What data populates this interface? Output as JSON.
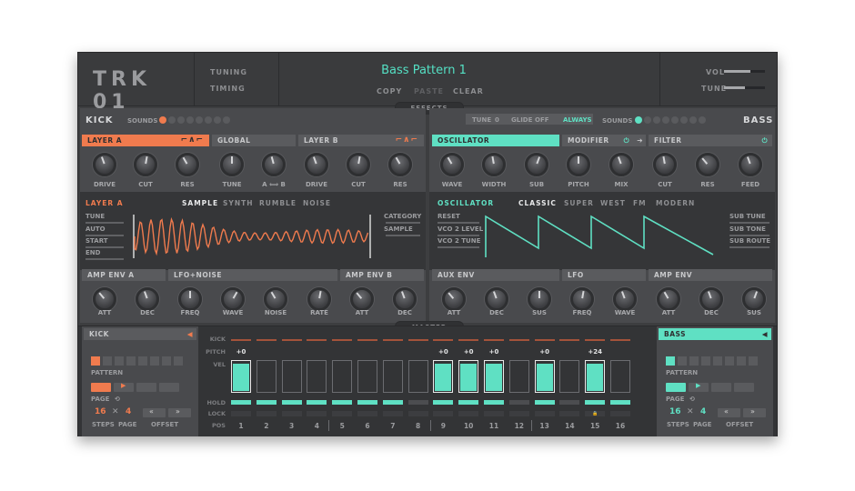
{
  "header": {
    "logo": "TRK 01",
    "tuning": "TUNING",
    "timing": "TIMING",
    "preset": "Bass Pattern 1",
    "copy": "COPY",
    "paste": "PASTE",
    "clear": "CLEAR",
    "vol": "VOL",
    "tune": "TUNE",
    "vol_level": 0.65,
    "tune_level": 0.5
  },
  "tabs": {
    "effects": "EFFECTS",
    "master": "MASTER"
  },
  "kick": {
    "title": "KICK",
    "sounds": "SOUNDS",
    "layer_a": "LAYER A",
    "global": "GLOBAL",
    "layer_b": "LAYER B",
    "knobs": [
      {
        "label": "DRIVE",
        "angle": -20
      },
      {
        "label": "CUT",
        "angle": 10
      },
      {
        "label": "RES",
        "angle": -30
      },
      {
        "label": "TUNE",
        "angle": 0
      },
      {
        "label": "A ⟺ B",
        "angle": -15
      },
      {
        "label": "DRIVE",
        "angle": -20
      },
      {
        "label": "CUT",
        "angle": 10
      },
      {
        "label": "RES",
        "angle": -30
      }
    ],
    "mode_label": "LAYER A",
    "modes": [
      "SAMPLE",
      "SYNTH",
      "RUMBLE",
      "NOISE"
    ],
    "params_left": [
      "TUNE",
      "AUTO",
      "START",
      "END"
    ],
    "params_right": [
      "CATEGORY",
      "SAMPLE"
    ],
    "env_a": "AMP ENV A",
    "lfo": "LFO+NOISE",
    "env_b": "AMP ENV B",
    "env_knobs": [
      {
        "label": "ATT",
        "angle": -40
      },
      {
        "label": "DEC",
        "angle": -20
      },
      {
        "label": "FREQ",
        "angle": 0
      },
      {
        "label": "WAVE",
        "angle": 30
      },
      {
        "label": "NOISE",
        "angle": -30
      },
      {
        "label": "RATE",
        "angle": 10
      },
      {
        "label": "ATT",
        "angle": -40
      },
      {
        "label": "DEC",
        "angle": -20
      }
    ]
  },
  "bass": {
    "title": "BASS",
    "tune_label": "TUNE",
    "tune_val": "0",
    "glide_label": "GLIDE",
    "glide_val": "OFF",
    "always": "ALWAYS",
    "sounds": "SOUNDS",
    "oscillator": "OSCILLATOR",
    "modifier": "MODIFIER",
    "filter": "FILTER",
    "knobs": [
      {
        "label": "WAVE",
        "angle": -30
      },
      {
        "label": "WIDTH",
        "angle": -10
      },
      {
        "label": "SUB",
        "angle": 20
      },
      {
        "label": "PITCH",
        "angle": 0
      },
      {
        "label": "MIX",
        "angle": -20
      },
      {
        "label": "CUT",
        "angle": -10
      },
      {
        "label": "RES",
        "angle": -40
      },
      {
        "label": "FEED",
        "angle": -20
      }
    ],
    "mode_label": "OSCILLATOR",
    "modes": [
      "CLASSIC",
      "SUPER",
      "WEST",
      "FM",
      "MODERN"
    ],
    "params_left": [
      "RESET",
      "VCO 2 LEVEL",
      "VCO 2 TUNE"
    ],
    "params_right": [
      "SUB TUNE",
      "SUB TONE",
      "SUB ROUTE"
    ],
    "env_a": "AUX ENV",
    "lfo": "LFO",
    "env_b": "AMP ENV",
    "env_knobs": [
      {
        "label": "ATT",
        "angle": -40
      },
      {
        "label": "DEC",
        "angle": -20
      },
      {
        "label": "SUS",
        "angle": 0
      },
      {
        "label": "FREQ",
        "angle": 10
      },
      {
        "label": "WAVE",
        "angle": -20
      },
      {
        "label": "ATT",
        "angle": -30
      },
      {
        "label": "DEC",
        "angle": -20
      },
      {
        "label": "SUS",
        "angle": 20
      }
    ]
  },
  "seq_left": {
    "title": "KICK",
    "pattern": "PATTERN",
    "page": "PAGE",
    "steps_val": "16",
    "page_val": "4",
    "steps": "STEPS",
    "page_lbl": "PAGE",
    "offset": "OFFSET",
    "x": "✕"
  },
  "seq_right": {
    "title": "BASS",
    "pattern": "PATTERN",
    "page": "PAGE",
    "steps_val": "16",
    "page_val": "4",
    "steps": "STEPS",
    "page_lbl": "PAGE",
    "offset": "OFFSET",
    "x": "✕"
  },
  "sequencer": {
    "row_labels": [
      "KICK",
      "PITCH",
      "VEL",
      "HOLD",
      "LOCK",
      "POS"
    ],
    "steps": [
      {
        "pos": "1",
        "pitch": "+0",
        "vel": 0.95,
        "hold": true
      },
      {
        "pos": "2",
        "pitch": "",
        "vel": 0,
        "hold": true
      },
      {
        "pos": "3",
        "pitch": "",
        "vel": 0,
        "hold": true
      },
      {
        "pos": "4",
        "pitch": "",
        "vel": 0,
        "hold": true
      },
      {
        "pos": "5",
        "pitch": "",
        "vel": 0,
        "hold": true
      },
      {
        "pos": "6",
        "pitch": "",
        "vel": 0,
        "hold": true
      },
      {
        "pos": "7",
        "pitch": "",
        "vel": 0,
        "hold": true
      },
      {
        "pos": "8",
        "pitch": "",
        "vel": 0,
        "hold": false
      },
      {
        "pos": "9",
        "pitch": "+0",
        "vel": 0.95,
        "hold": true
      },
      {
        "pos": "10",
        "pitch": "+0",
        "vel": 0.95,
        "hold": true
      },
      {
        "pos": "11",
        "pitch": "+0",
        "vel": 0.95,
        "hold": true
      },
      {
        "pos": "12",
        "pitch": "",
        "vel": 0,
        "hold": false
      },
      {
        "pos": "13",
        "pitch": "+0",
        "vel": 0.95,
        "hold": true
      },
      {
        "pos": "14",
        "pitch": "",
        "vel": 0,
        "hold": false
      },
      {
        "pos": "15",
        "pitch": "+24",
        "vel": 0.95,
        "hold": true
      },
      {
        "pos": "16",
        "pitch": "",
        "vel": 0,
        "hold": true
      }
    ]
  }
}
